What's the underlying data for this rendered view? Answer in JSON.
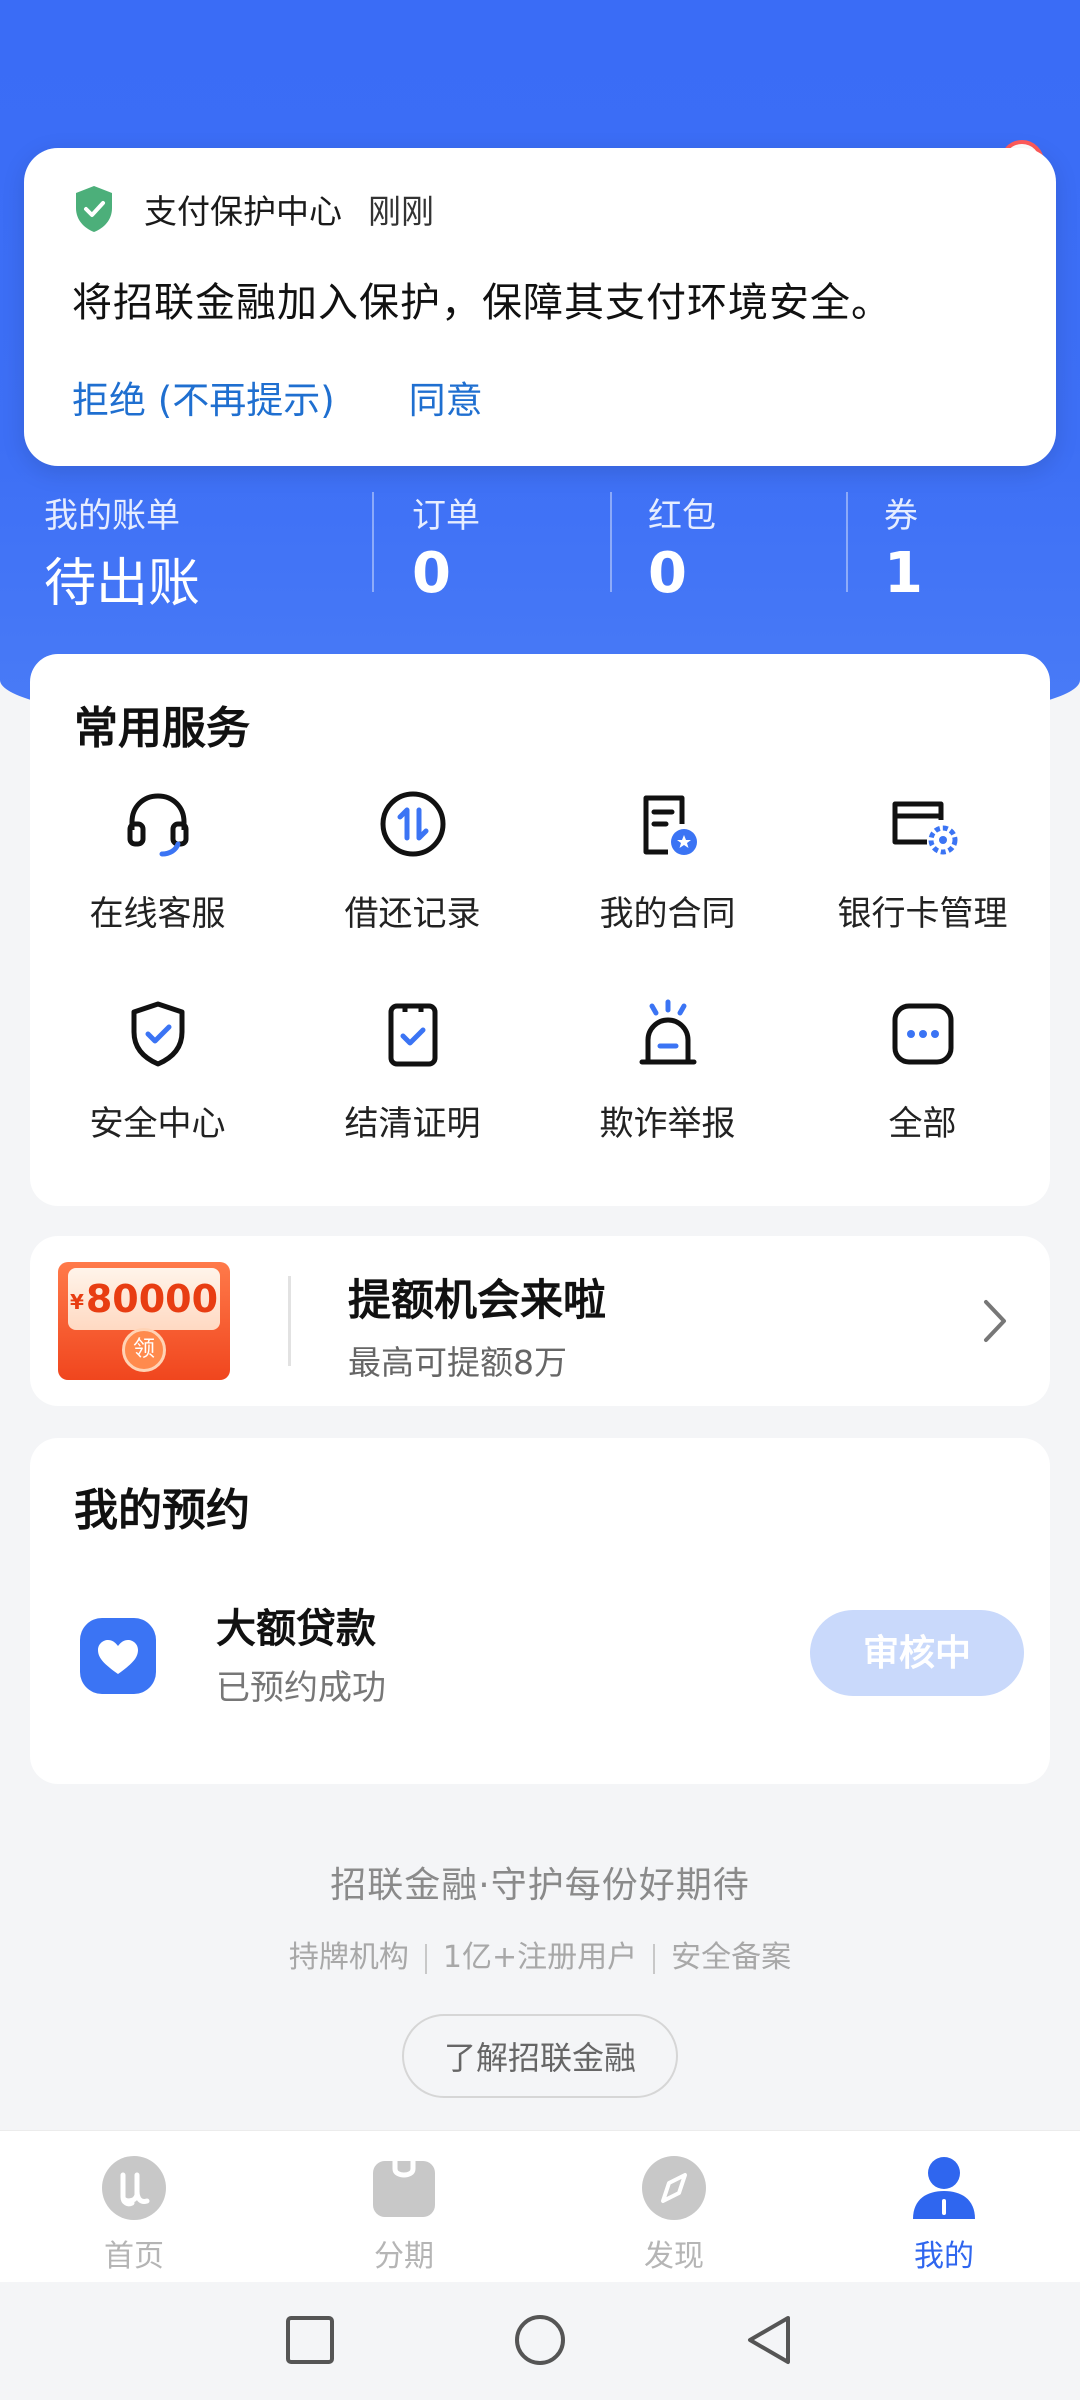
{
  "notification": {
    "app_name": "支付保护中心",
    "time": "刚刚",
    "message": "将招联金融加入保护，保障其支付环境安全。",
    "reject_label": "拒绝 (不再提示)",
    "accept_label": "同意"
  },
  "account": {
    "bill_label": "我的账单",
    "bill_value": "待出账",
    "orders_label": "订单",
    "orders_value": "0",
    "redpacket_label": "红包",
    "redpacket_value": "0",
    "coupon_label": "券",
    "coupon_value": "1"
  },
  "services": {
    "title": "常用服务",
    "items": [
      {
        "label": "在线客服",
        "icon": "headset-icon"
      },
      {
        "label": "借还记录",
        "icon": "transfer-icon"
      },
      {
        "label": "我的合同",
        "icon": "contract-icon"
      },
      {
        "label": "银行卡管理",
        "icon": "bank-card-settings-icon"
      },
      {
        "label": "安全中心",
        "icon": "shield-check-icon"
      },
      {
        "label": "结清证明",
        "icon": "clipboard-check-icon"
      },
      {
        "label": "欺诈举报",
        "icon": "alarm-icon"
      },
      {
        "label": "全部",
        "icon": "more-icon"
      }
    ]
  },
  "promo": {
    "coupon_currency": "¥",
    "coupon_amount": "80000",
    "coupon_seal": "领",
    "title": "提额机会来啦",
    "subtitle": "最高可提额8万"
  },
  "reservation": {
    "title": "我的预约",
    "item_name": "大额贷款",
    "item_status": "已预约成功",
    "button_label": "审核中"
  },
  "footer": {
    "slogan": "招联金融·守护每份好期待",
    "badge_1": "持牌机构",
    "badge_2": "1亿+注册用户",
    "badge_3": "安全备案",
    "learn_button": "了解招联金融"
  },
  "nav": {
    "home": "首页",
    "installment": "分期",
    "discover": "发现",
    "mine": "我的"
  },
  "colors": {
    "brand_blue": "#3b6ff5",
    "link_blue": "#1f6fd0",
    "accent_orange": "#f0461e"
  }
}
